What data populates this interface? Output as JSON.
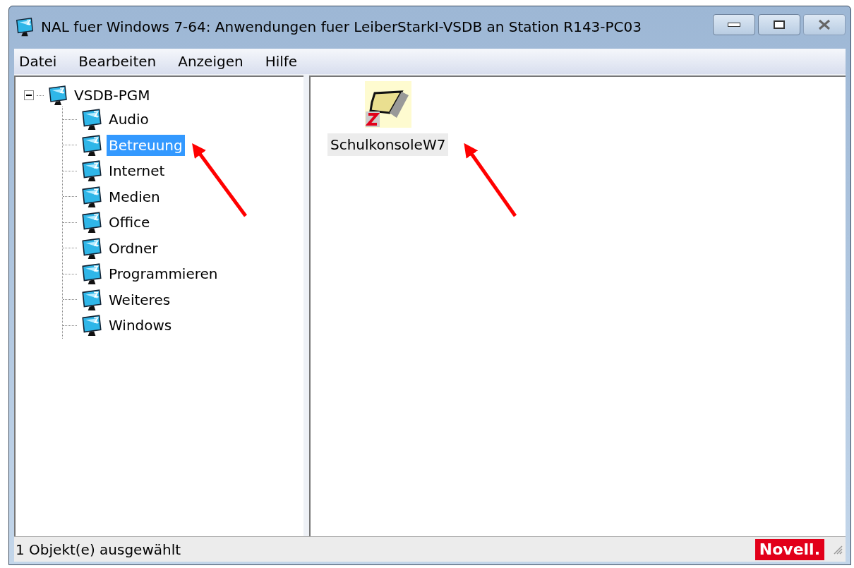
{
  "window": {
    "title": "NAL fuer Windows 7-64: Anwendungen fuer LeiberStarkI-VSDB an Station R143-PC03"
  },
  "menu": [
    "Datei",
    "Bearbeiten",
    "Anzeigen",
    "Hilfe"
  ],
  "tree": [
    {
      "label": "VSDB-PGM",
      "expanded": true,
      "selected": false,
      "children": [
        {
          "label": "Audio",
          "selected": false
        },
        {
          "label": "Betreuung",
          "selected": true
        },
        {
          "label": "Internet",
          "selected": false
        },
        {
          "label": "Medien",
          "selected": false
        },
        {
          "label": "Office",
          "selected": false
        },
        {
          "label": "Ordner",
          "selected": false
        },
        {
          "label": "Programmieren",
          "selected": false
        },
        {
          "label": "Weiteres",
          "selected": false
        },
        {
          "label": "Windows",
          "selected": false
        }
      ]
    }
  ],
  "applications": [
    {
      "label": "SchulkonsoleW7",
      "selected": true
    }
  ],
  "status_bar": {
    "text": "1 Objekt(e) ausgewählt",
    "logo": "Novell."
  }
}
